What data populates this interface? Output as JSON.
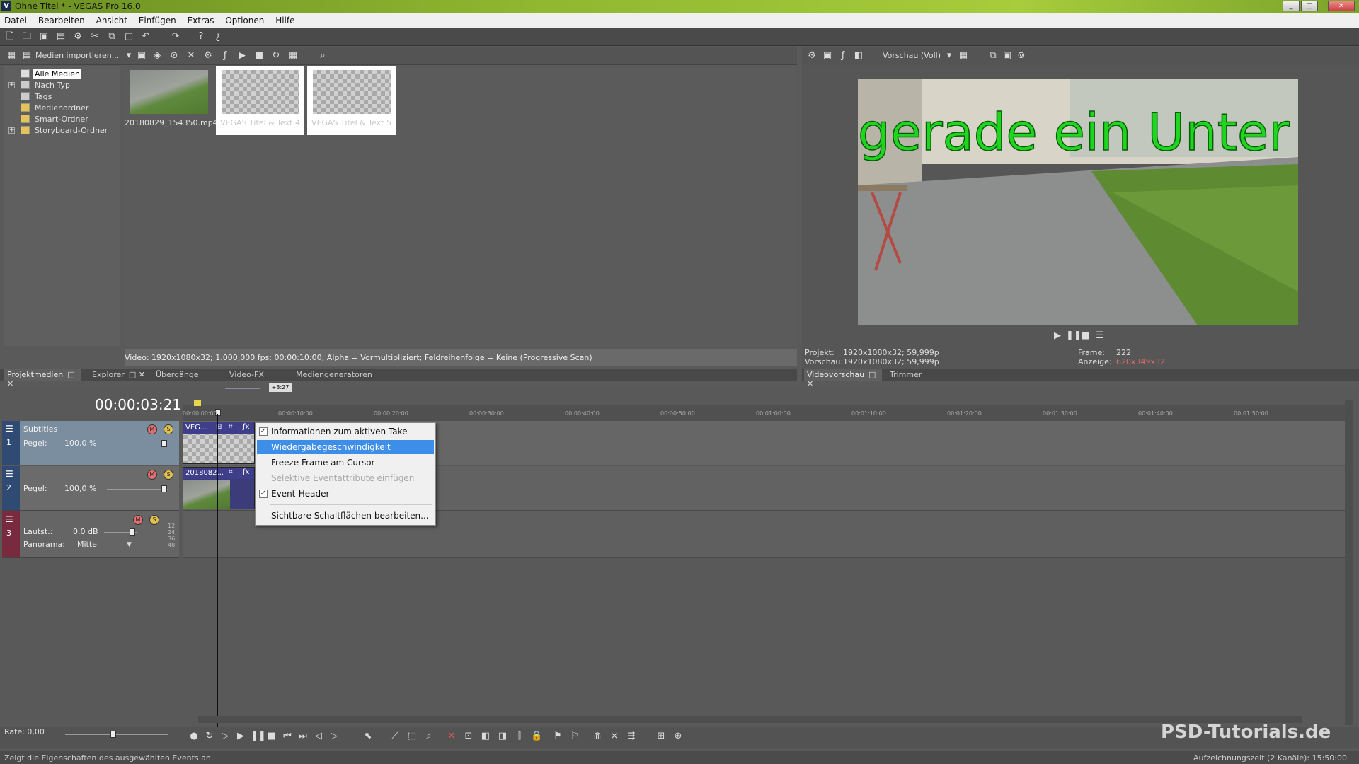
{
  "window": {
    "title": "Ohne Titel * - VEGAS Pro 16.0",
    "app_icon": "V"
  },
  "menu": [
    "Datei",
    "Bearbeiten",
    "Ansicht",
    "Einfügen",
    "Extras",
    "Optionen",
    "Hilfe"
  ],
  "media": {
    "import_label": "Medien importieren...",
    "tree": [
      {
        "label": "Alle Medien",
        "selected": true
      },
      {
        "label": "Nach Typ"
      },
      {
        "label": "Tags"
      },
      {
        "label": "Medienordner"
      },
      {
        "label": "Smart-Ordner"
      },
      {
        "label": "Storyboard-Ordner"
      }
    ],
    "thumbs": [
      {
        "caption": "20180829_154350.mp4"
      },
      {
        "caption": "VEGAS Titel & Text 4"
      },
      {
        "caption": "VEGAS Titel & Text 5"
      }
    ],
    "info": "Video: 1920x1080x32; 1.000,000 fps; 00:00:10:00; Alpha = Vormultipliziert; Feldreihenfolge = Keine (Progressive Scan)",
    "tabs": [
      "Projektmedien",
      "Explorer",
      "Übergänge",
      "Video-FX",
      "Mediengeneratoren"
    ]
  },
  "preview": {
    "mode": "Vorschau (Voll)",
    "overlay_text": "gerade ein Unter",
    "projekt_label": "Projekt:",
    "projekt_value": "1920x1080x32; 59,999p",
    "vorschau_label": "Vorschau:",
    "vorschau_value": "1920x1080x32; 59,999p",
    "frame_label": "Frame:",
    "frame_value": "222",
    "anzeige_label": "Anzeige:",
    "anzeige_value": "620x349x32",
    "tabs": [
      "Videovorschau",
      "Trimmer"
    ]
  },
  "timeline": {
    "timecode": "00:00:03:21",
    "marker_label": "+3:27",
    "ruler": [
      "00:00:00:00",
      "00:00:10:00",
      "00:00:20:00",
      "00:00:30:00",
      "00:00:40:00",
      "00:00:50:00",
      "00:01:00:00",
      "00:01:10:00",
      "00:01:20:00",
      "00:01:30:00",
      "00:01:40:00",
      "00:01:50:00"
    ],
    "tracks": [
      {
        "num": "1",
        "name": "Subtitles",
        "level_label": "Pegel:",
        "level_value": "100,0 %",
        "event": "VEG..."
      },
      {
        "num": "2",
        "name": "",
        "level_label": "Pegel:",
        "level_value": "100,0 %",
        "event": "2018082..."
      },
      {
        "num": "3",
        "vol_label": "Lautst.:",
        "vol_value": "0,0 dB",
        "pan_label": "Panorama:",
        "pan_value": "Mitte",
        "meter": [
          "12",
          "24",
          "36",
          "48"
        ]
      }
    ]
  },
  "context_menu": [
    {
      "label": "Informationen zum aktiven Take",
      "checked": true
    },
    {
      "label": "Wiedergabegeschwindigkeit",
      "highlight": true
    },
    {
      "label": "Freeze Frame am Cursor"
    },
    {
      "label": "Selektive Eventattribute einfügen",
      "disabled": true
    },
    {
      "label": "Event-Header",
      "checked": true
    },
    {
      "label": "Sichtbare Schaltflächen bearbeiten..."
    }
  ],
  "rate": "Rate: 0,00",
  "status": {
    "left": "Zeigt die Eigenschaften des ausgewählten Events an.",
    "right": "Aufzeichnungszeit (2 Kanäle): 15:50:00"
  },
  "watermark": "PSD-Tutorials.de",
  "colors": {
    "accent": "#3d8ee8",
    "title_green": "#90b830",
    "overlay_text": "#1fd61f",
    "anzeige": "#e06a6a"
  }
}
